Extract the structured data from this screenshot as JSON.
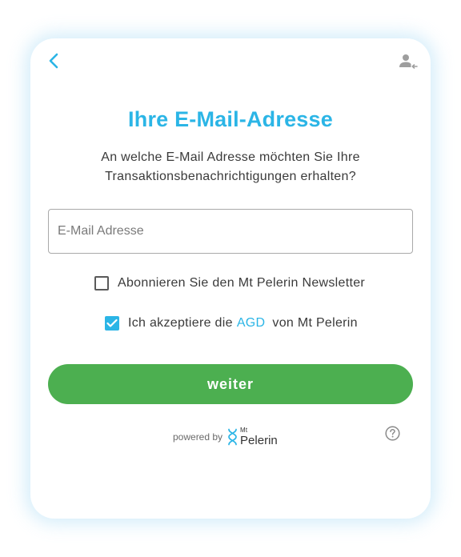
{
  "colors": {
    "accent": "#2bb5e6",
    "button": "#4caf50",
    "text": "#3a3a3a"
  },
  "header": {
    "back_icon": "chevron-left-icon",
    "user_icon": "user-logout-icon"
  },
  "title": "Ihre E-Mail-Adresse",
  "subtitle_line1": "An welche E-Mail Adresse möchten Sie Ihre",
  "subtitle_line2": "Transaktionsbenachrichtigungen erhalten?",
  "email": {
    "placeholder": "E-Mail Adresse",
    "value": ""
  },
  "newsletter": {
    "label": "Abonnieren Sie den Mt Pelerin Newsletter",
    "checked": false
  },
  "terms": {
    "prefix": "Ich akzeptiere die",
    "link": "AGD",
    "suffix": "von Mt Pelerin",
    "checked": true
  },
  "submit_label": "weiter",
  "footer": {
    "powered_by": "powered by",
    "logo_small": "Mt",
    "logo_big": "Pelerin",
    "help_icon": "question-circle-icon"
  }
}
